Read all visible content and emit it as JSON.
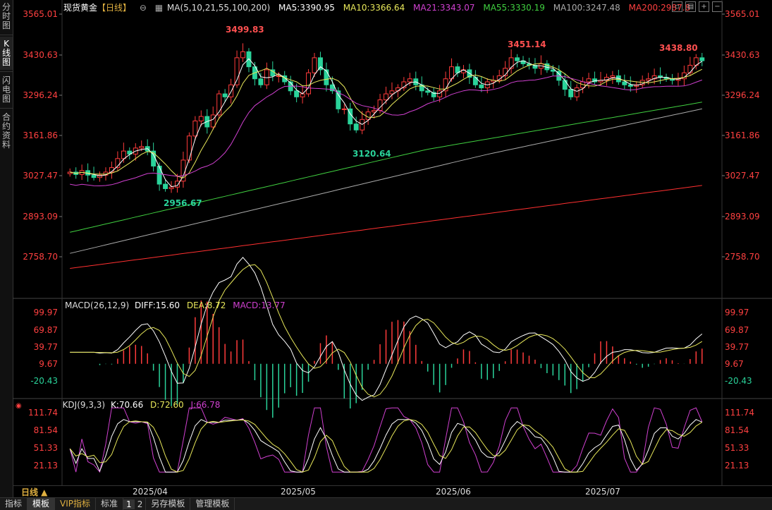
{
  "left_tabs": [
    "分时图",
    "K线图",
    "闪电图",
    "合约资料"
  ],
  "header": {
    "title": "现货黄金",
    "period": "【日线】",
    "ma_label": "MA(5,10,21,55,100,200)",
    "ma5": "MA5:3390.95",
    "ma10": "MA10:3366.64",
    "ma21": "MA21:3343.07",
    "ma55": "MA55:3330.19",
    "ma100": "MA100:3247.48",
    "ma200": "MA200:2987.8"
  },
  "price_axis": [
    "3565.01",
    "3430.63",
    "3296.24",
    "3161.86",
    "3027.47",
    "2893.09",
    "2758.70"
  ],
  "annotations": {
    "high1": "3499.83",
    "high2": "3451.14",
    "high3": "3438.80",
    "low1": "2956.67",
    "low2": "3120.64"
  },
  "macd": {
    "label": "MACD(26,12,9)",
    "diff": "DIFF:15.60",
    "dea": "DEA:8.72",
    "macd": "MACD:13.77",
    "axis": [
      "99.97",
      "69.87",
      "39.77",
      "9.67",
      "-20.43"
    ]
  },
  "kdj": {
    "label": "KDJ(9,3,3)",
    "k": "K:70.66",
    "d": "D:72.60",
    "j": "J:66.78",
    "axis": [
      "111.74",
      "81.54",
      "51.33",
      "21.13"
    ]
  },
  "date_axis": [
    "2025/04",
    "2025/05",
    "2025/06",
    "2025/07"
  ],
  "period_button": "日线 ▲",
  "bottom_tabs": [
    "指标",
    "模板",
    "VIP指标",
    "标准",
    "1",
    "2",
    "另存模板",
    "管理模板"
  ],
  "colors": {
    "up": "#ff3b3b",
    "down": "#2ad39a",
    "ma5": "#ffffff",
    "ma10": "#e8e85a",
    "ma21": "#d040d0",
    "ma55": "#40d040",
    "ma100": "#aaaaaa",
    "ma200": "#ff3030"
  }
}
